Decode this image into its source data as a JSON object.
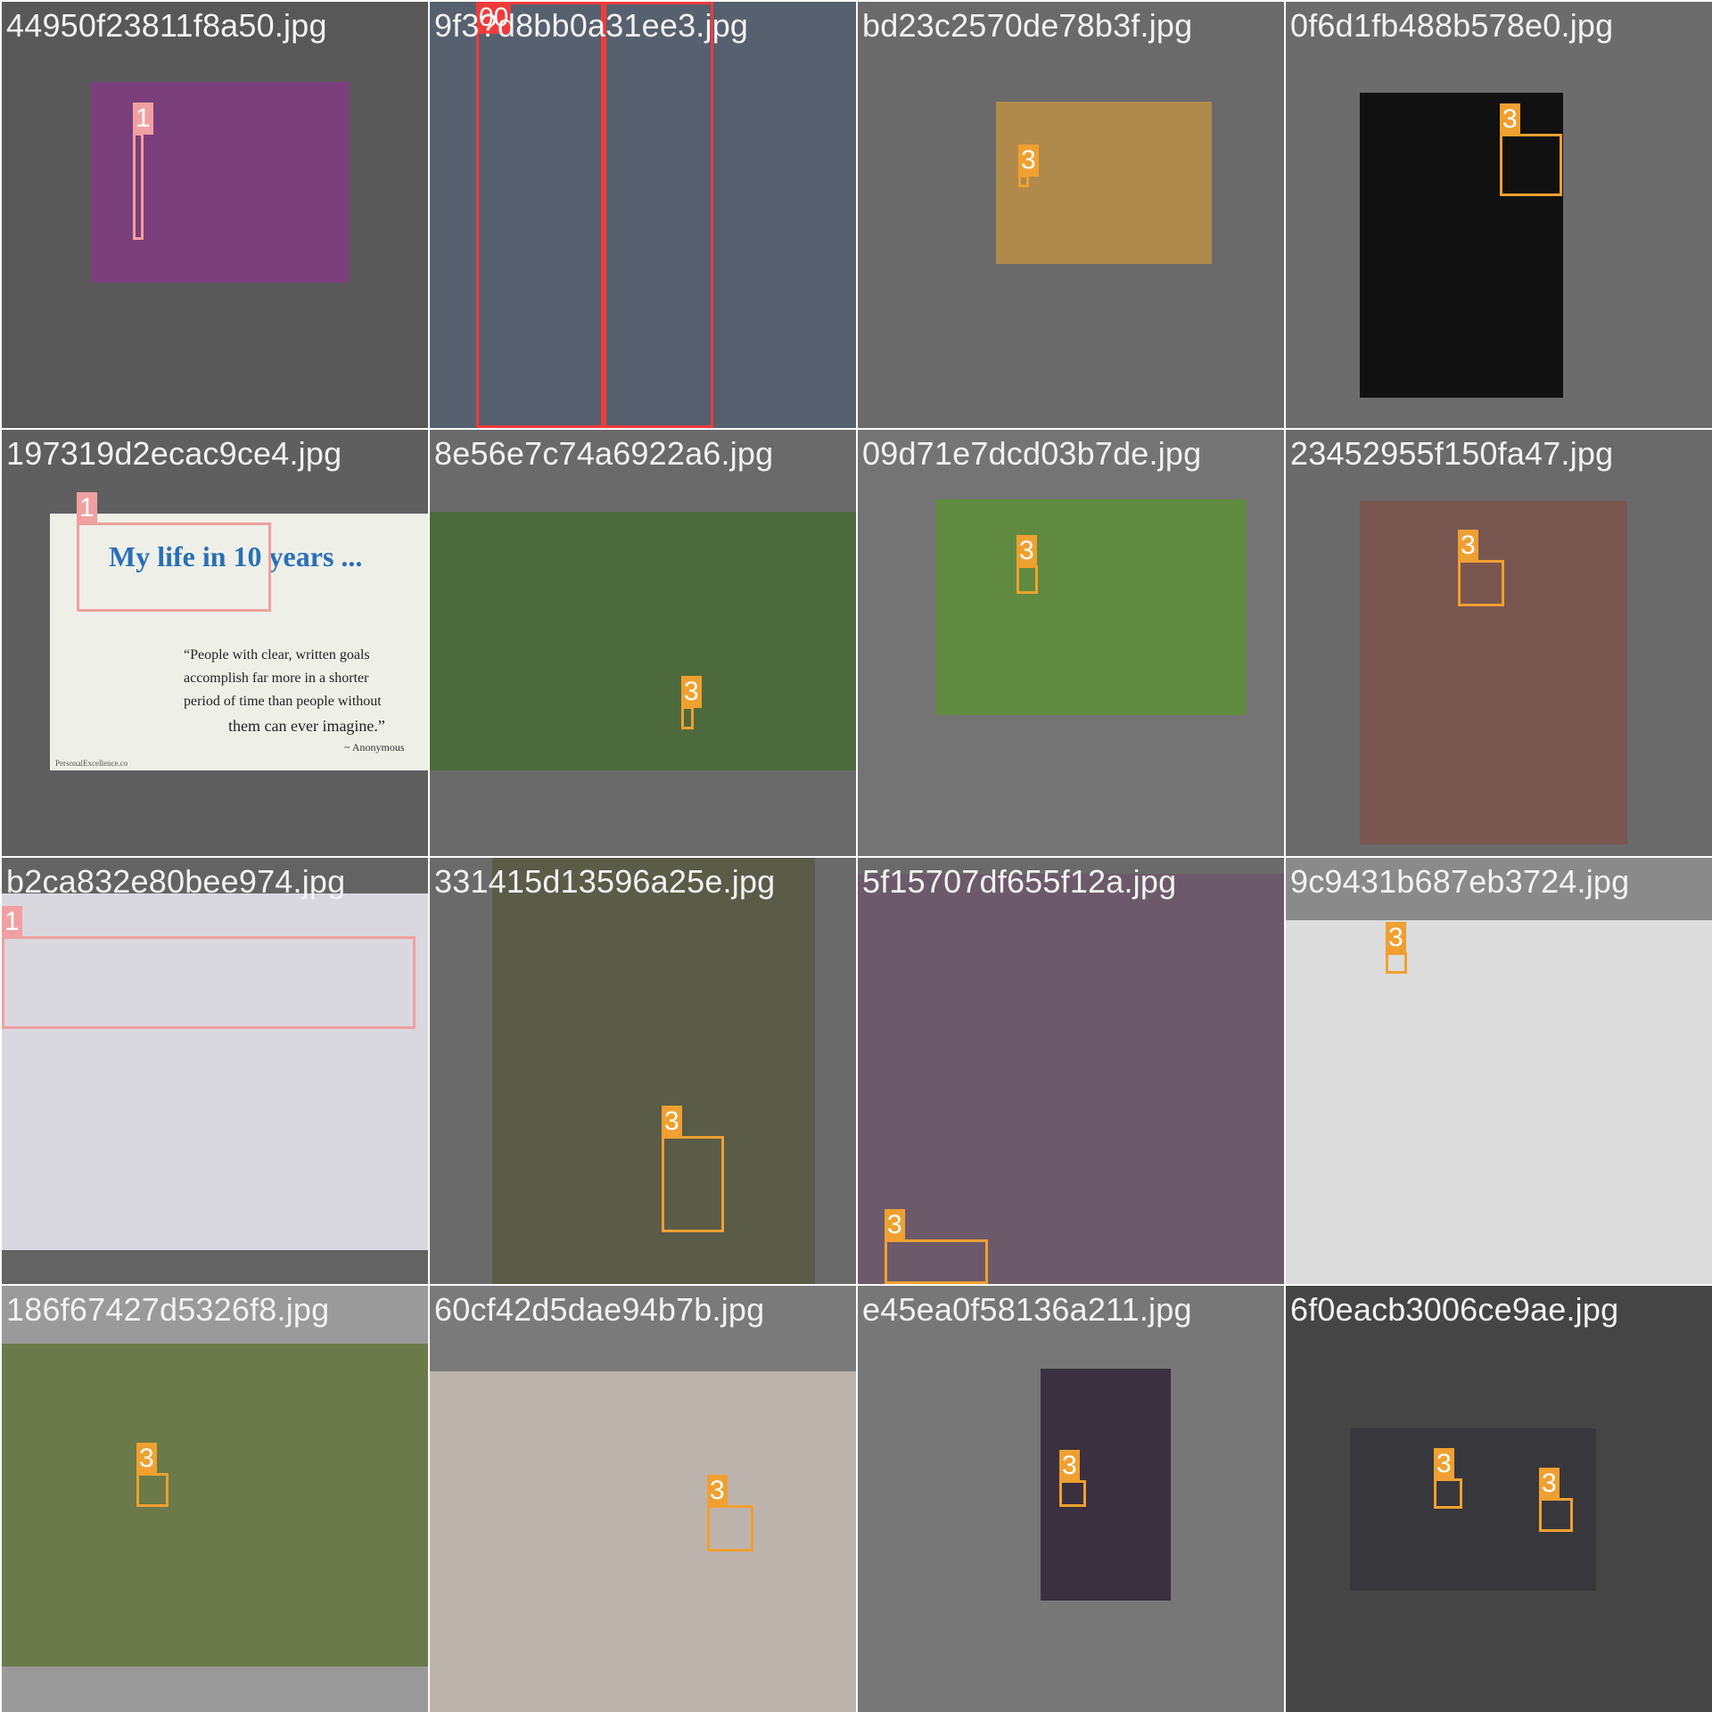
{
  "grid": {
    "cells": [
      {
        "file": "44950f23811f8a50.jpg",
        "bg": "#585858",
        "photo_color": "#7a3f7a",
        "boxes": [
          {
            "label": "1",
            "color": "#f0a0a0"
          }
        ]
      },
      {
        "file": "9f3?d8bb0a31ee3.jpg",
        "bg": "#4a5360",
        "photo_color": "#56606e",
        "boxes": [
          {
            "label": "00",
            "color": "#ef3b3b"
          },
          {
            "label": "",
            "color": "#ef3b3b"
          }
        ]
      },
      {
        "file": "bd23c2570de78b3f.jpg",
        "bg": "#6a6a6a",
        "photo_color": "#b08a4a",
        "boxes": [
          {
            "label": "3",
            "color": "#f0a030"
          }
        ]
      },
      {
        "file": "0f6d1fb488b578e0.jpg",
        "bg": "#6c6c6c",
        "photo_color": "#111111",
        "boxes": [
          {
            "label": "3",
            "color": "#f0a030"
          }
        ]
      },
      {
        "file": "197319d2ecac9ce4.jpg",
        "bg": "#5f5f5f",
        "photo_color": "#eef0e8",
        "boxes": [
          {
            "label": "1",
            "color": "#f0a0a0"
          }
        ],
        "photo_text": [
          "My life in 10 years ...",
          "“People with clear, written goals",
          "accomplish far more in a shorter",
          "period of time than people without",
          "them can ever imagine.”",
          "~ Anonymous",
          "PersonalExcellence.co"
        ]
      },
      {
        "file": "8e56e7c74a6922a6.jpg",
        "bg": "#6a6a6a",
        "photo_color": "#4c6a3c",
        "boxes": [
          {
            "label": "3",
            "color": "#f0a030"
          }
        ]
      },
      {
        "file": "09d71e7dcd03b7de.jpg",
        "bg": "#747474",
        "photo_color": "#5f8a3f",
        "boxes": [
          {
            "label": "3",
            "color": "#f0a030"
          }
        ]
      },
      {
        "file": "23452955f150fa47.jpg",
        "bg": "#6a6a6a",
        "photo_color": "#7a5650",
        "boxes": [
          {
            "label": "3",
            "color": "#f0a030"
          }
        ]
      },
      {
        "file": "b2ca832e80bee974.jpg",
        "bg": "#636363",
        "photo_color": "#d8d8de",
        "boxes": [
          {
            "label": "1",
            "color": "#f0a0a0"
          }
        ]
      },
      {
        "file": "331415d13596a25e.jpg",
        "bg": "#6a6a6a",
        "photo_color": "#5a5c48",
        "boxes": [
          {
            "label": "3",
            "color": "#f0a030"
          }
        ]
      },
      {
        "file": "5f15707df655f12a.jpg",
        "bg": "#6a6a6a",
        "photo_color": "#6c5a6a",
        "boxes": [
          {
            "label": "3",
            "color": "#f0a030"
          }
        ]
      },
      {
        "file": "9c9431b687eb3724.jpg",
        "bg": "#8a8a8a",
        "photo_color": "#dcdcdc",
        "boxes": [
          {
            "label": "3",
            "color": "#f0a030"
          }
        ]
      },
      {
        "file": "186f67427d5326f8.jpg",
        "bg": "#9a9a9a",
        "photo_color": "#6a7a48",
        "boxes": [
          {
            "label": "3",
            "color": "#f0a030"
          }
        ]
      },
      {
        "file": "60cf42d5dae94b7b.jpg",
        "bg": "#7a7a7a",
        "photo_color": "#bdb3ad",
        "boxes": [
          {
            "label": "3",
            "color": "#f0a030"
          }
        ]
      },
      {
        "file": "e45ea0f58136a211.jpg",
        "bg": "#777777",
        "photo_color": "#3a3040",
        "boxes": [
          {
            "label": "3",
            "color": "#f0a030"
          }
        ]
      },
      {
        "file": "6f0eacb3006ce9ae.jpg",
        "bg": "#454545",
        "photo_color": "#38383c",
        "boxes": [
          {
            "label": "3",
            "color": "#f0a030"
          },
          {
            "label": "3",
            "color": "#f0a030"
          }
        ]
      }
    ]
  }
}
